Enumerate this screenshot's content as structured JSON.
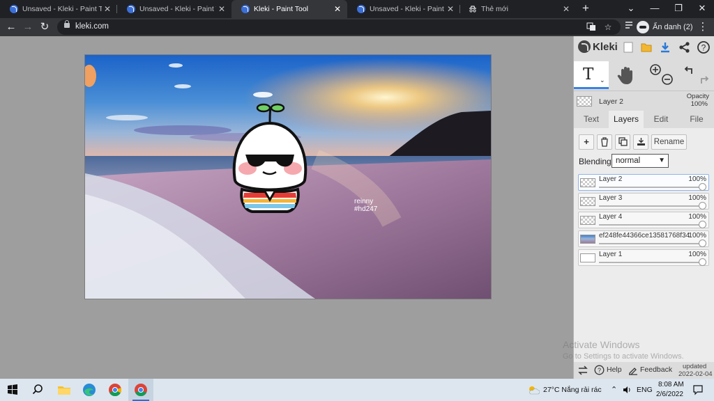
{
  "browser": {
    "tabs": [
      {
        "title": "Unsaved - Kleki - Paint Tool",
        "active": false
      },
      {
        "title": "Unsaved - Kleki - Paint Tool",
        "active": false
      },
      {
        "title": "Kleki - Paint Tool",
        "active": true
      },
      {
        "title": "Unsaved - Kleki - Paint Tool",
        "active": false
      },
      {
        "title": "Thẻ mới",
        "active": false
      }
    ],
    "new_tab": "+",
    "window": {
      "dropdown": "⌄",
      "minimize": "—",
      "restore": "❐",
      "close": "✕"
    },
    "url": "kleki.com",
    "profile_label": "Ẩn danh (2)"
  },
  "canvas": {
    "sticker_text_1": "reinny",
    "sticker_text_2": "#hd247"
  },
  "kleki": {
    "app_name": "Kleki",
    "tool_text_glyph": "T",
    "layer_name": "Layer 2",
    "opacity_label": "Opacity",
    "opacity_value": "100%",
    "tabs": [
      "Text",
      "Layers",
      "Edit",
      "File"
    ],
    "active_tab": "Layers",
    "rename_label": "Rename",
    "blending_label": "Blending",
    "blending_value": "normal",
    "layers": [
      {
        "name": "Layer 2",
        "opacity": "100%",
        "selected": true,
        "thumb": "transparent"
      },
      {
        "name": "Layer 3",
        "opacity": "100%",
        "selected": false,
        "thumb": "transparent"
      },
      {
        "name": "Layer 4",
        "opacity": "100%",
        "selected": false,
        "thumb": "transparent"
      },
      {
        "name": "ef248fe44366ce13581768f34",
        "opacity": "100%",
        "selected": false,
        "thumb": "photo"
      },
      {
        "name": "Layer 1",
        "opacity": "100%",
        "selected": false,
        "thumb": "white"
      }
    ],
    "activate_title": "Activate Windows",
    "activate_sub": "Go to Settings to activate Windows.",
    "help_label": "Help",
    "feedback_label": "Feedback",
    "updated_label": "updated",
    "updated_date": "2022-02-04"
  },
  "taskbar": {
    "weather": "27°C  Nắng rải rác",
    "language": "ENG",
    "time": "8:08 AM",
    "date": "2/6/2022"
  }
}
